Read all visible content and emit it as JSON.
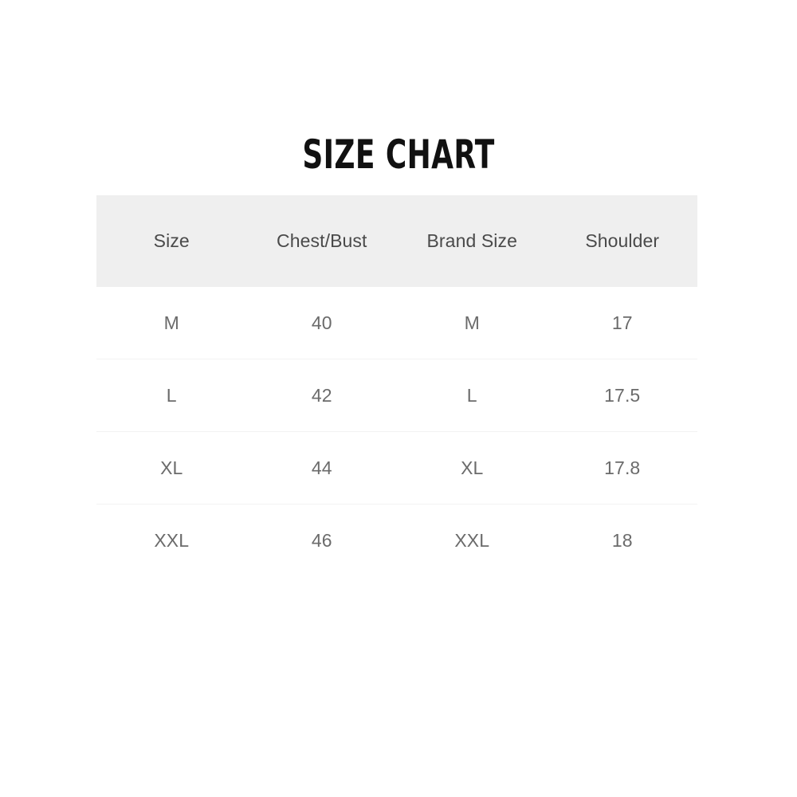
{
  "title": "SIZE CHART",
  "colors": {
    "page_background": "#ffffff",
    "header_background": "#efefef",
    "title_text": "#111111",
    "header_text": "#4a4a4a",
    "body_text": "#6b6b6b",
    "row_divider": "#f2f2f2"
  },
  "table": {
    "columns": [
      "Size",
      "Chest/Bust",
      "Brand Size",
      "Shoulder"
    ],
    "rows": [
      [
        "M",
        "40",
        "M",
        "17"
      ],
      [
        "L",
        "42",
        "L",
        "17.5"
      ],
      [
        "XL",
        "44",
        "XL",
        "17.8"
      ],
      [
        "XXL",
        "46",
        "XXL",
        "18"
      ]
    ]
  },
  "chart_data": {
    "type": "table",
    "title": "SIZE CHART",
    "columns": [
      "Size",
      "Chest/Bust",
      "Brand Size",
      "Shoulder"
    ],
    "rows": [
      {
        "Size": "M",
        "Chest/Bust": 40,
        "Brand Size": "M",
        "Shoulder": 17
      },
      {
        "Size": "L",
        "Chest/Bust": 42,
        "Brand Size": "L",
        "Shoulder": 17.5
      },
      {
        "Size": "XL",
        "Chest/Bust": 44,
        "Brand Size": "XL",
        "Shoulder": 17.8
      },
      {
        "Size": "XXL",
        "Chest/Bust": 46,
        "Brand Size": "XXL",
        "Shoulder": 18
      }
    ]
  }
}
